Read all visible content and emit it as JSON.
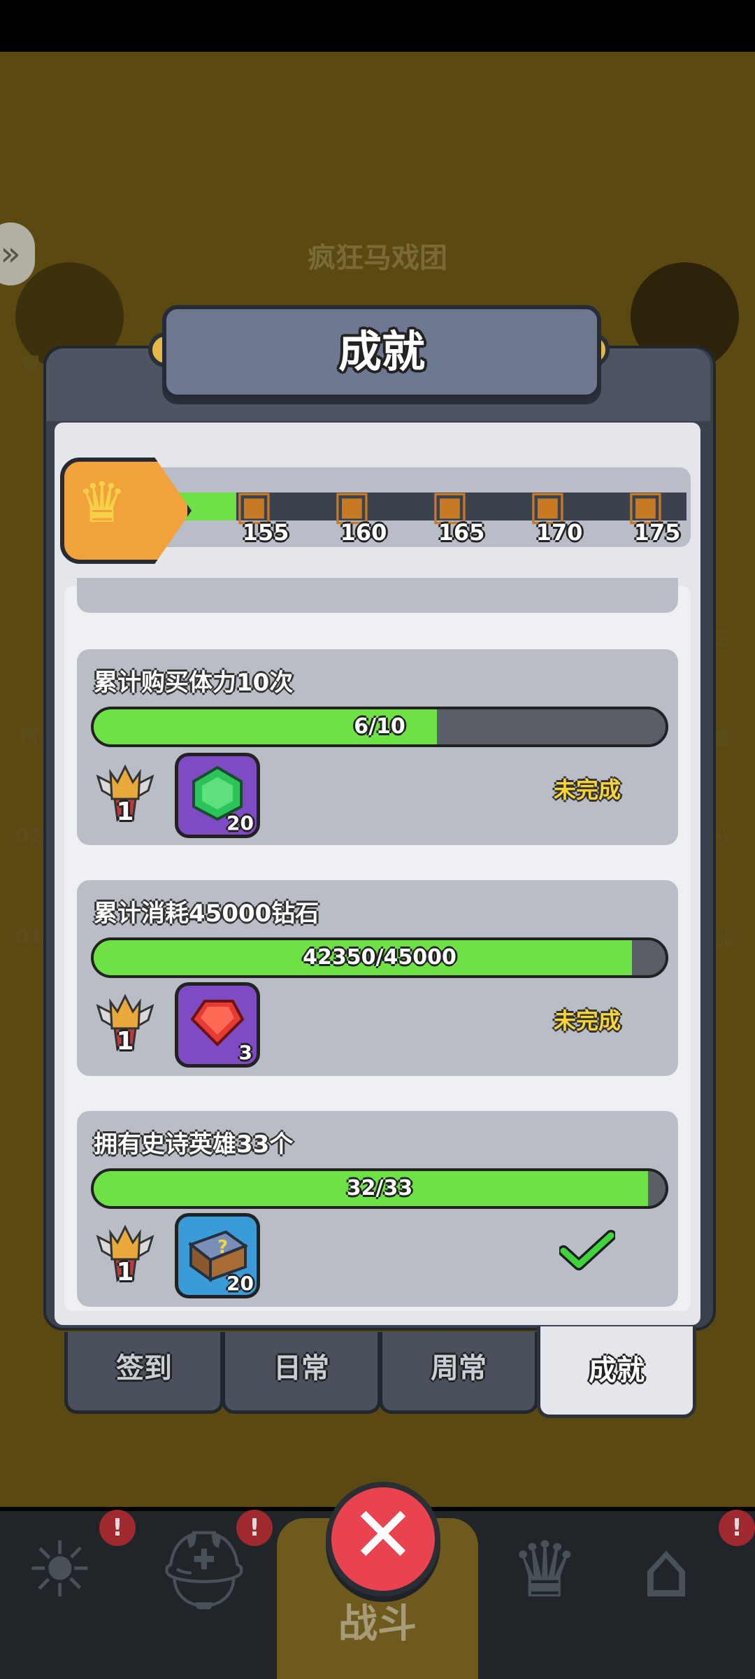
{
  "background": {
    "scene_title": "疯狂马戏团",
    "side_labels_left": [
      "冒",
      "精",
      "02",
      "01"
    ],
    "side_labels_right": [
      "告",
      "惠",
      "欢",
      "战"
    ],
    "bottom_nav": {
      "center_label": "战斗",
      "badge": "!"
    },
    "left_arrow_icon": "double-chevron-right"
  },
  "modal": {
    "title": "成就",
    "milestones": [
      {
        "value": "155",
        "icon": "treasure-chest"
      },
      {
        "value": "160",
        "icon": "treasure-chest"
      },
      {
        "value": "165",
        "icon": "treasure-chest"
      },
      {
        "value": "170",
        "icon": "treasure-chest"
      },
      {
        "value": "175",
        "icon": "treasure-chest"
      }
    ],
    "milestone_progress": 0.12,
    "achievements": [
      {
        "title": "累计购买体力10次",
        "progress_text": "6/10",
        "progress": 0.6,
        "medal_points": "1",
        "reward_icon": "green-gem",
        "reward_count": "20",
        "status": "未完成"
      },
      {
        "title": "累计消耗45000钻石",
        "progress_text": "42350/45000",
        "progress": 0.941,
        "medal_points": "1",
        "reward_icon": "red-gem",
        "reward_count": "3",
        "status": "未完成"
      },
      {
        "title": "拥有史诗英雄33个",
        "progress_text": "32/33",
        "progress": 0.97,
        "medal_points": "1",
        "reward_icon": "mystery-chest",
        "reward_count": "20",
        "status": "completed-check"
      }
    ],
    "tabs": [
      {
        "label": "签到",
        "active": false
      },
      {
        "label": "日常",
        "active": false
      },
      {
        "label": "周常",
        "active": false
      },
      {
        "label": "成就",
        "active": true
      }
    ]
  },
  "colors": {
    "accent_green": "#6ee144",
    "status_yellow": "#f6d53c",
    "close_red": "#e8434f"
  }
}
